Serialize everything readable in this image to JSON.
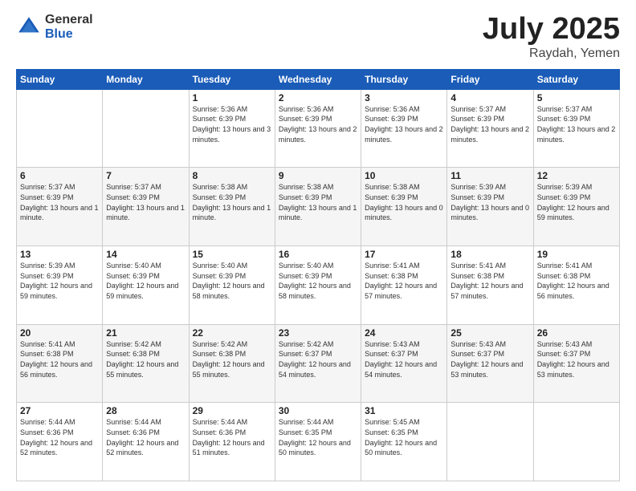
{
  "logo": {
    "general": "General",
    "blue": "Blue"
  },
  "title": {
    "month": "July 2025",
    "location": "Raydah, Yemen"
  },
  "weekdays": [
    "Sunday",
    "Monday",
    "Tuesday",
    "Wednesday",
    "Thursday",
    "Friday",
    "Saturday"
  ],
  "weeks": [
    [
      {
        "day": "",
        "info": ""
      },
      {
        "day": "",
        "info": ""
      },
      {
        "day": "1",
        "info": "Sunrise: 5:36 AM\nSunset: 6:39 PM\nDaylight: 13 hours and 3 minutes."
      },
      {
        "day": "2",
        "info": "Sunrise: 5:36 AM\nSunset: 6:39 PM\nDaylight: 13 hours and 2 minutes."
      },
      {
        "day": "3",
        "info": "Sunrise: 5:36 AM\nSunset: 6:39 PM\nDaylight: 13 hours and 2 minutes."
      },
      {
        "day": "4",
        "info": "Sunrise: 5:37 AM\nSunset: 6:39 PM\nDaylight: 13 hours and 2 minutes."
      },
      {
        "day": "5",
        "info": "Sunrise: 5:37 AM\nSunset: 6:39 PM\nDaylight: 13 hours and 2 minutes."
      }
    ],
    [
      {
        "day": "6",
        "info": "Sunrise: 5:37 AM\nSunset: 6:39 PM\nDaylight: 13 hours and 1 minute."
      },
      {
        "day": "7",
        "info": "Sunrise: 5:37 AM\nSunset: 6:39 PM\nDaylight: 13 hours and 1 minute."
      },
      {
        "day": "8",
        "info": "Sunrise: 5:38 AM\nSunset: 6:39 PM\nDaylight: 13 hours and 1 minute."
      },
      {
        "day": "9",
        "info": "Sunrise: 5:38 AM\nSunset: 6:39 PM\nDaylight: 13 hours and 1 minute."
      },
      {
        "day": "10",
        "info": "Sunrise: 5:38 AM\nSunset: 6:39 PM\nDaylight: 13 hours and 0 minutes."
      },
      {
        "day": "11",
        "info": "Sunrise: 5:39 AM\nSunset: 6:39 PM\nDaylight: 13 hours and 0 minutes."
      },
      {
        "day": "12",
        "info": "Sunrise: 5:39 AM\nSunset: 6:39 PM\nDaylight: 12 hours and 59 minutes."
      }
    ],
    [
      {
        "day": "13",
        "info": "Sunrise: 5:39 AM\nSunset: 6:39 PM\nDaylight: 12 hours and 59 minutes."
      },
      {
        "day": "14",
        "info": "Sunrise: 5:40 AM\nSunset: 6:39 PM\nDaylight: 12 hours and 59 minutes."
      },
      {
        "day": "15",
        "info": "Sunrise: 5:40 AM\nSunset: 6:39 PM\nDaylight: 12 hours and 58 minutes."
      },
      {
        "day": "16",
        "info": "Sunrise: 5:40 AM\nSunset: 6:39 PM\nDaylight: 12 hours and 58 minutes."
      },
      {
        "day": "17",
        "info": "Sunrise: 5:41 AM\nSunset: 6:38 PM\nDaylight: 12 hours and 57 minutes."
      },
      {
        "day": "18",
        "info": "Sunrise: 5:41 AM\nSunset: 6:38 PM\nDaylight: 12 hours and 57 minutes."
      },
      {
        "day": "19",
        "info": "Sunrise: 5:41 AM\nSunset: 6:38 PM\nDaylight: 12 hours and 56 minutes."
      }
    ],
    [
      {
        "day": "20",
        "info": "Sunrise: 5:41 AM\nSunset: 6:38 PM\nDaylight: 12 hours and 56 minutes."
      },
      {
        "day": "21",
        "info": "Sunrise: 5:42 AM\nSunset: 6:38 PM\nDaylight: 12 hours and 55 minutes."
      },
      {
        "day": "22",
        "info": "Sunrise: 5:42 AM\nSunset: 6:38 PM\nDaylight: 12 hours and 55 minutes."
      },
      {
        "day": "23",
        "info": "Sunrise: 5:42 AM\nSunset: 6:37 PM\nDaylight: 12 hours and 54 minutes."
      },
      {
        "day": "24",
        "info": "Sunrise: 5:43 AM\nSunset: 6:37 PM\nDaylight: 12 hours and 54 minutes."
      },
      {
        "day": "25",
        "info": "Sunrise: 5:43 AM\nSunset: 6:37 PM\nDaylight: 12 hours and 53 minutes."
      },
      {
        "day": "26",
        "info": "Sunrise: 5:43 AM\nSunset: 6:37 PM\nDaylight: 12 hours and 53 minutes."
      }
    ],
    [
      {
        "day": "27",
        "info": "Sunrise: 5:44 AM\nSunset: 6:36 PM\nDaylight: 12 hours and 52 minutes."
      },
      {
        "day": "28",
        "info": "Sunrise: 5:44 AM\nSunset: 6:36 PM\nDaylight: 12 hours and 52 minutes."
      },
      {
        "day": "29",
        "info": "Sunrise: 5:44 AM\nSunset: 6:36 PM\nDaylight: 12 hours and 51 minutes."
      },
      {
        "day": "30",
        "info": "Sunrise: 5:44 AM\nSunset: 6:35 PM\nDaylight: 12 hours and 50 minutes."
      },
      {
        "day": "31",
        "info": "Sunrise: 5:45 AM\nSunset: 6:35 PM\nDaylight: 12 hours and 50 minutes."
      },
      {
        "day": "",
        "info": ""
      },
      {
        "day": "",
        "info": ""
      }
    ]
  ]
}
